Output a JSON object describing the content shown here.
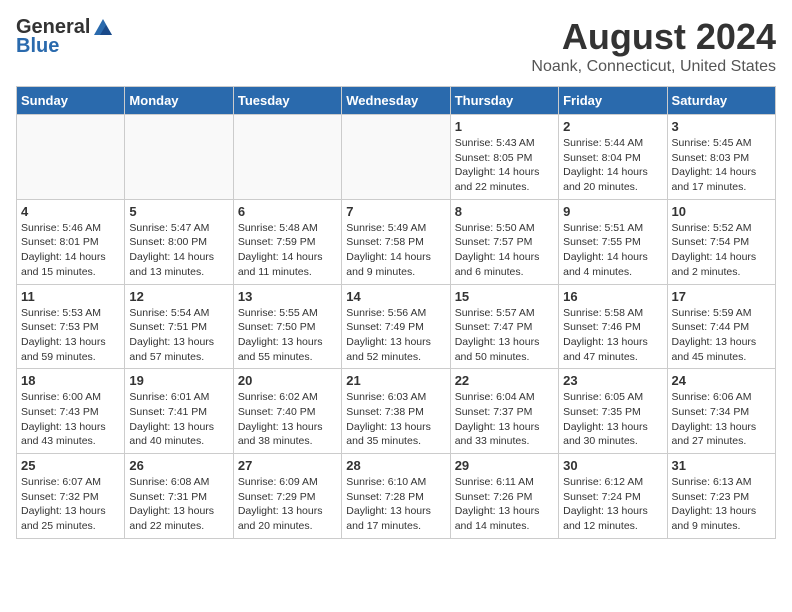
{
  "header": {
    "logo_general": "General",
    "logo_blue": "Blue",
    "month": "August 2024",
    "location": "Noank, Connecticut, United States"
  },
  "weekdays": [
    "Sunday",
    "Monday",
    "Tuesday",
    "Wednesday",
    "Thursday",
    "Friday",
    "Saturday"
  ],
  "weeks": [
    [
      {
        "day": "",
        "info": ""
      },
      {
        "day": "",
        "info": ""
      },
      {
        "day": "",
        "info": ""
      },
      {
        "day": "",
        "info": ""
      },
      {
        "day": "1",
        "info": "Sunrise: 5:43 AM\nSunset: 8:05 PM\nDaylight: 14 hours\nand 22 minutes."
      },
      {
        "day": "2",
        "info": "Sunrise: 5:44 AM\nSunset: 8:04 PM\nDaylight: 14 hours\nand 20 minutes."
      },
      {
        "day": "3",
        "info": "Sunrise: 5:45 AM\nSunset: 8:03 PM\nDaylight: 14 hours\nand 17 minutes."
      }
    ],
    [
      {
        "day": "4",
        "info": "Sunrise: 5:46 AM\nSunset: 8:01 PM\nDaylight: 14 hours\nand 15 minutes."
      },
      {
        "day": "5",
        "info": "Sunrise: 5:47 AM\nSunset: 8:00 PM\nDaylight: 14 hours\nand 13 minutes."
      },
      {
        "day": "6",
        "info": "Sunrise: 5:48 AM\nSunset: 7:59 PM\nDaylight: 14 hours\nand 11 minutes."
      },
      {
        "day": "7",
        "info": "Sunrise: 5:49 AM\nSunset: 7:58 PM\nDaylight: 14 hours\nand 9 minutes."
      },
      {
        "day": "8",
        "info": "Sunrise: 5:50 AM\nSunset: 7:57 PM\nDaylight: 14 hours\nand 6 minutes."
      },
      {
        "day": "9",
        "info": "Sunrise: 5:51 AM\nSunset: 7:55 PM\nDaylight: 14 hours\nand 4 minutes."
      },
      {
        "day": "10",
        "info": "Sunrise: 5:52 AM\nSunset: 7:54 PM\nDaylight: 14 hours\nand 2 minutes."
      }
    ],
    [
      {
        "day": "11",
        "info": "Sunrise: 5:53 AM\nSunset: 7:53 PM\nDaylight: 13 hours\nand 59 minutes."
      },
      {
        "day": "12",
        "info": "Sunrise: 5:54 AM\nSunset: 7:51 PM\nDaylight: 13 hours\nand 57 minutes."
      },
      {
        "day": "13",
        "info": "Sunrise: 5:55 AM\nSunset: 7:50 PM\nDaylight: 13 hours\nand 55 minutes."
      },
      {
        "day": "14",
        "info": "Sunrise: 5:56 AM\nSunset: 7:49 PM\nDaylight: 13 hours\nand 52 minutes."
      },
      {
        "day": "15",
        "info": "Sunrise: 5:57 AM\nSunset: 7:47 PM\nDaylight: 13 hours\nand 50 minutes."
      },
      {
        "day": "16",
        "info": "Sunrise: 5:58 AM\nSunset: 7:46 PM\nDaylight: 13 hours\nand 47 minutes."
      },
      {
        "day": "17",
        "info": "Sunrise: 5:59 AM\nSunset: 7:44 PM\nDaylight: 13 hours\nand 45 minutes."
      }
    ],
    [
      {
        "day": "18",
        "info": "Sunrise: 6:00 AM\nSunset: 7:43 PM\nDaylight: 13 hours\nand 43 minutes."
      },
      {
        "day": "19",
        "info": "Sunrise: 6:01 AM\nSunset: 7:41 PM\nDaylight: 13 hours\nand 40 minutes."
      },
      {
        "day": "20",
        "info": "Sunrise: 6:02 AM\nSunset: 7:40 PM\nDaylight: 13 hours\nand 38 minutes."
      },
      {
        "day": "21",
        "info": "Sunrise: 6:03 AM\nSunset: 7:38 PM\nDaylight: 13 hours\nand 35 minutes."
      },
      {
        "day": "22",
        "info": "Sunrise: 6:04 AM\nSunset: 7:37 PM\nDaylight: 13 hours\nand 33 minutes."
      },
      {
        "day": "23",
        "info": "Sunrise: 6:05 AM\nSunset: 7:35 PM\nDaylight: 13 hours\nand 30 minutes."
      },
      {
        "day": "24",
        "info": "Sunrise: 6:06 AM\nSunset: 7:34 PM\nDaylight: 13 hours\nand 27 minutes."
      }
    ],
    [
      {
        "day": "25",
        "info": "Sunrise: 6:07 AM\nSunset: 7:32 PM\nDaylight: 13 hours\nand 25 minutes."
      },
      {
        "day": "26",
        "info": "Sunrise: 6:08 AM\nSunset: 7:31 PM\nDaylight: 13 hours\nand 22 minutes."
      },
      {
        "day": "27",
        "info": "Sunrise: 6:09 AM\nSunset: 7:29 PM\nDaylight: 13 hours\nand 20 minutes."
      },
      {
        "day": "28",
        "info": "Sunrise: 6:10 AM\nSunset: 7:28 PM\nDaylight: 13 hours\nand 17 minutes."
      },
      {
        "day": "29",
        "info": "Sunrise: 6:11 AM\nSunset: 7:26 PM\nDaylight: 13 hours\nand 14 minutes."
      },
      {
        "day": "30",
        "info": "Sunrise: 6:12 AM\nSunset: 7:24 PM\nDaylight: 13 hours\nand 12 minutes."
      },
      {
        "day": "31",
        "info": "Sunrise: 6:13 AM\nSunset: 7:23 PM\nDaylight: 13 hours\nand 9 minutes."
      }
    ]
  ]
}
